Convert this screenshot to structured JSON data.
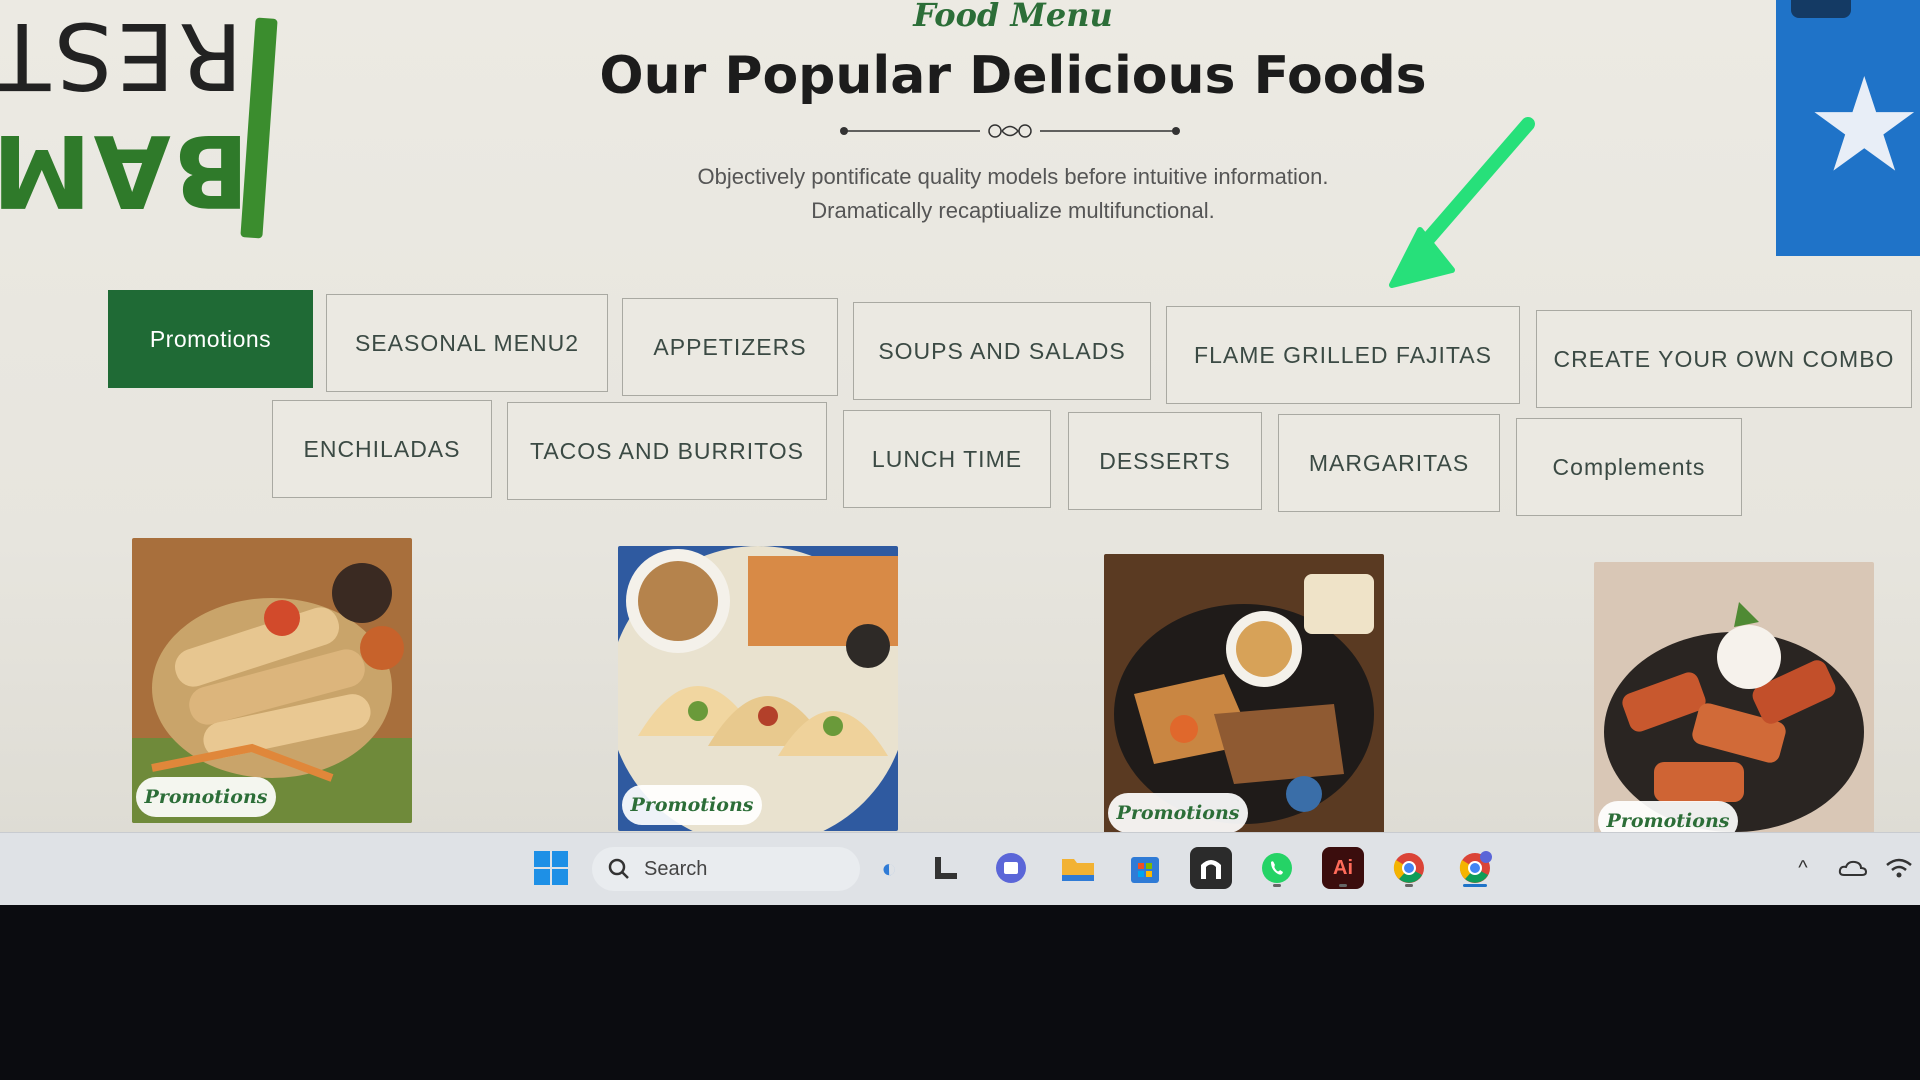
{
  "header": {
    "eyebrow": "Food Menu",
    "title": "Our Popular Delicious Foods",
    "subtitle_line1": "Objectively pontificate quality models before intuitive information.",
    "subtitle_line2": "Dramatically recaptiualize multifunctional."
  },
  "logo": {
    "text_top": "REST",
    "text_bottom": "BAM"
  },
  "tabs_row1": [
    "Promotions",
    "SEASONAL MENU2",
    "APPETIZERS",
    "SOUPS AND SALADS",
    "FLAME GRILLED FAJITAS",
    "CREATE YOUR OWN COMBO"
  ],
  "tabs_row2": [
    "ENCHILADAS",
    "TACOS AND BURRITOS",
    "LUNCH TIME",
    "DESSERTS",
    "MARGARITAS",
    "Complements"
  ],
  "active_tab": "Promotions",
  "cards": [
    {
      "badge": "Promotions",
      "image": "flautas-image"
    },
    {
      "badge": "Promotions",
      "image": "tacos-image"
    },
    {
      "badge": "Promotions",
      "image": "fajitas-image"
    },
    {
      "badge": "Promotions",
      "image": "dessert-image"
    }
  ],
  "taskbar": {
    "search_label": "Search",
    "icons": [
      "windows-start-icon",
      "search-icon",
      "copilot-icon",
      "task-view-icon",
      "teams-icon",
      "file-explorer-icon",
      "store-icon",
      "app-icon",
      "whatsapp-icon",
      "illustrator-icon",
      "chrome-icon",
      "chrome-profile-icon"
    ],
    "illustrator_label": "Ai"
  },
  "colors": {
    "accent": "#1f6a35",
    "arrow": "#27e07a",
    "flag": "#1f73c8"
  }
}
